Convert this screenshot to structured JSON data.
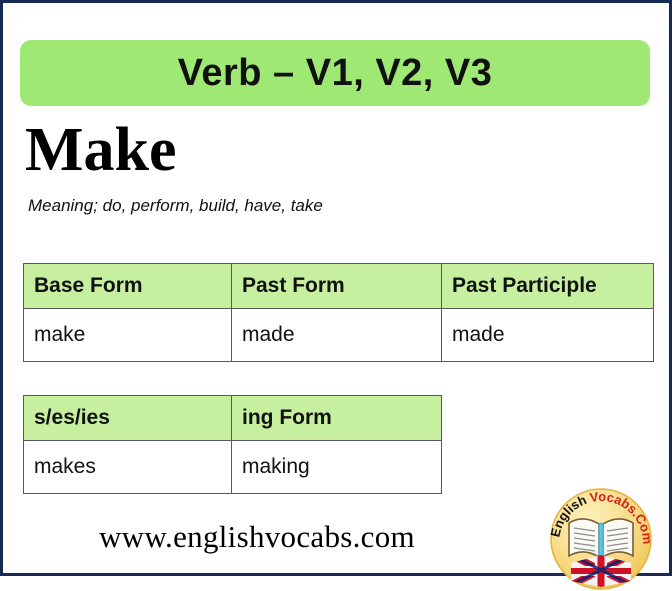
{
  "banner": {
    "title": "Verb – V1, V2, V3",
    "background_color": "#9FE873"
  },
  "word": {
    "headword": "Make",
    "meaning": "Meaning; do, perform, build, have, take"
  },
  "tables": {
    "main": {
      "headers": [
        "Base Form",
        "Past Form",
        "Past Participle"
      ],
      "values": [
        "make",
        "made",
        "made"
      ],
      "header_background": "#C6F0A0"
    },
    "extra": {
      "headers": [
        "s/es/ies",
        "ing Form"
      ],
      "values": [
        "makes",
        "making"
      ],
      "header_background": "#C6F0A0"
    }
  },
  "footer": {
    "site_url": "www.englishvocabs.com"
  },
  "logo": {
    "text_primary": "English",
    "text_secondary": "Vocabs.Com",
    "primary_color": "#111111",
    "secondary_color": "#D0211C",
    "badge_color": "#F6D469",
    "icons": [
      "open-book-icon",
      "uk-flag-icon"
    ]
  },
  "frame": {
    "border_color": "#172B54"
  }
}
